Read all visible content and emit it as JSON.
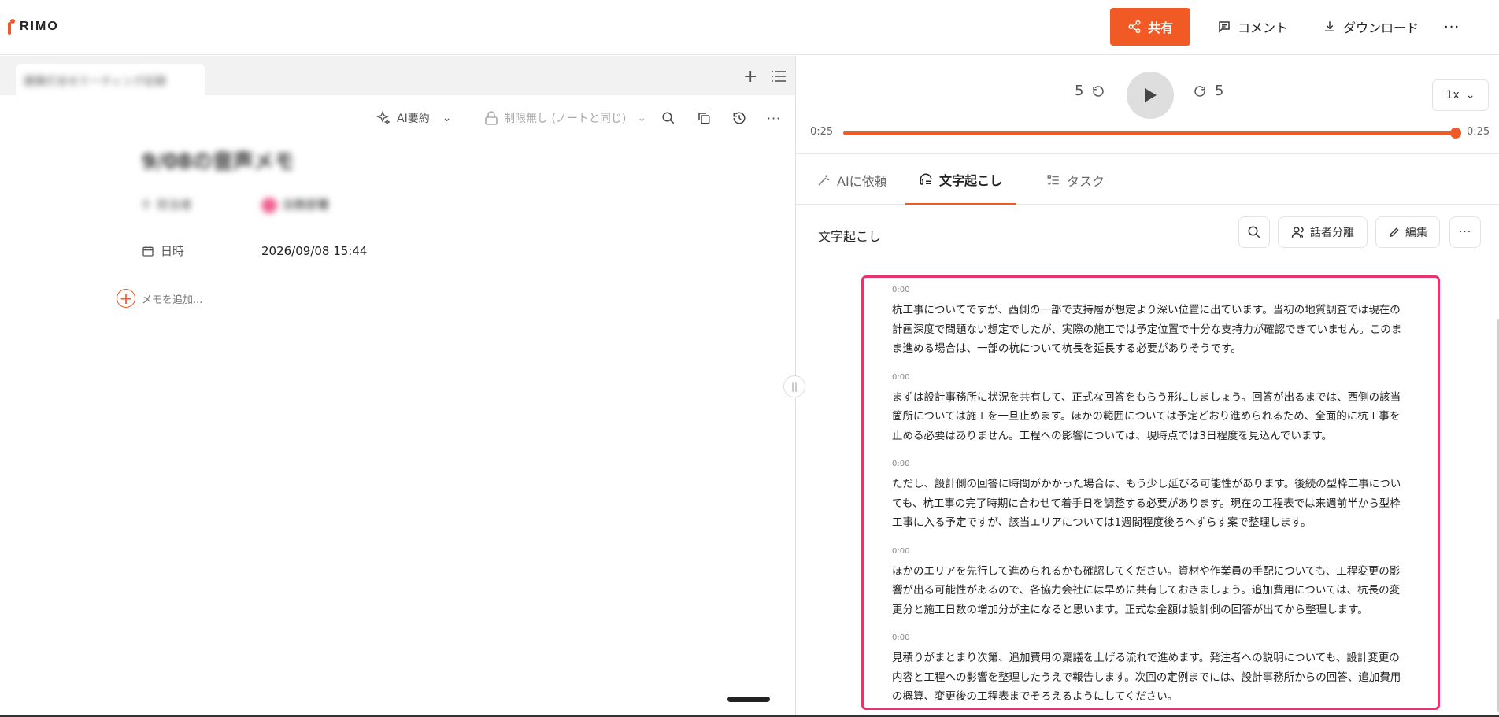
{
  "app": {
    "logo_text": "RIMO",
    "brand_color": "#f15a24",
    "highlight_color": "#e8336d"
  },
  "header": {
    "share_label": "共有",
    "comment_label": "コメント",
    "download_label": "ダウンロード",
    "more_label": "···"
  },
  "left": {
    "tab_title": "建築打合せミーティング記録",
    "toolbar": {
      "ai_summary_label": "AI要約",
      "permission_label": "制限無し (ノートと同じ)"
    },
    "note_title": "9/08の音声メモ",
    "owner": {
      "label": "担当者",
      "value": "法務部署"
    },
    "datetime": {
      "label": "日時",
      "value": "2026/09/08 15:44"
    },
    "add_memo_label": "メモを追加..."
  },
  "player": {
    "skip_back": "5",
    "skip_forward": "5",
    "speed": "1x",
    "time_current": "0:25",
    "time_total": "0:25",
    "progress": 1.0
  },
  "tabs": {
    "ai_request": "AIに依頼",
    "transcript": "文字起こし",
    "tasks": "タスク"
  },
  "transcript_panel": {
    "title": "文字起こし",
    "speaker_split_label": "話者分離",
    "edit_label": "編集",
    "more_label": "···",
    "segments": [
      {
        "time": "0:00",
        "text": "杭工事についてですが、西側の一部で支持層が想定より深い位置に出ています。当初の地質調査では現在の計画深度で問題ない想定でしたが、実際の施工では予定位置で十分な支持力が確認できていません。このまま進める場合は、一部の杭について杭長を延長する必要がありそうです。"
      },
      {
        "time": "0:00",
        "text": "まずは設計事務所に状況を共有して、正式な回答をもらう形にしましょう。回答が出るまでは、西側の該当箇所については施工を一旦止めます。ほかの範囲については予定どおり進められるため、全面的に杭工事を止める必要はありません。工程への影響については、現時点では3日程度を見込んでいます。"
      },
      {
        "time": "0:00",
        "text": "ただし、設計側の回答に時間がかかった場合は、もう少し延びる可能性があります。後続の型枠工事についても、杭工事の完了時期に合わせて着手日を調整する必要があります。現在の工程表では来週前半から型枠工事に入る予定ですが、該当エリアについては1週間程度後ろへずらす案で整理します。"
      },
      {
        "time": "0:00",
        "text": "ほかのエリアを先行して進められるかも確認してください。資材や作業員の手配についても、工程変更の影響が出る可能性があるので、各協力会社には早めに共有しておきましょう。追加費用については、杭長の変更分と施工日数の増加分が主になると思います。正式な金額は設計側の回答が出てから整理します。"
      },
      {
        "time": "0:00",
        "text": "見積りがまとまり次第、追加費用の稟議を上げる流れで進めます。発注者への説明についても、設計変更の内容と工程への影響を整理したうえで報告します。次回の定例までには、設計事務所からの回答、追加費用の概算、変更後の工程表までそろえるようにしてください。"
      }
    ]
  }
}
